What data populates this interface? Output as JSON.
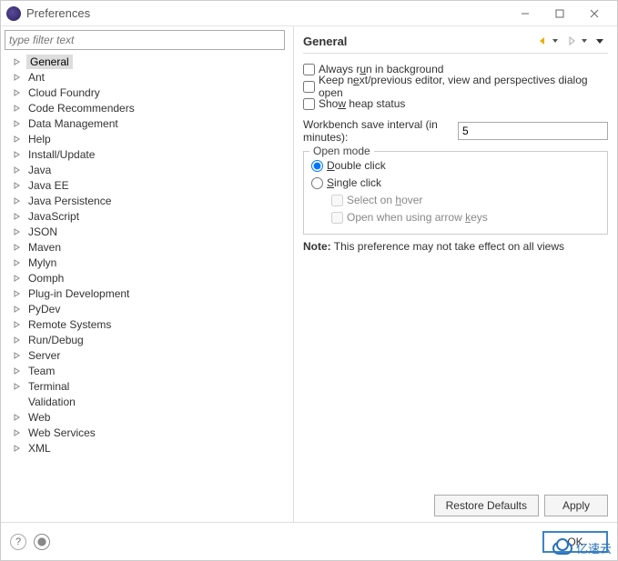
{
  "window": {
    "title": "Preferences"
  },
  "filter": {
    "placeholder": "type filter text"
  },
  "tree": {
    "items": [
      {
        "label": "General",
        "expandable": true,
        "selected": true
      },
      {
        "label": "Ant",
        "expandable": true
      },
      {
        "label": "Cloud Foundry",
        "expandable": true
      },
      {
        "label": "Code Recommenders",
        "expandable": true
      },
      {
        "label": "Data Management",
        "expandable": true
      },
      {
        "label": "Help",
        "expandable": true
      },
      {
        "label": "Install/Update",
        "expandable": true
      },
      {
        "label": "Java",
        "expandable": true
      },
      {
        "label": "Java EE",
        "expandable": true
      },
      {
        "label": "Java Persistence",
        "expandable": true
      },
      {
        "label": "JavaScript",
        "expandable": true
      },
      {
        "label": "JSON",
        "expandable": true
      },
      {
        "label": "Maven",
        "expandable": true
      },
      {
        "label": "Mylyn",
        "expandable": true
      },
      {
        "label": "Oomph",
        "expandable": true
      },
      {
        "label": "Plug-in Development",
        "expandable": true
      },
      {
        "label": "PyDev",
        "expandable": true
      },
      {
        "label": "Remote Systems",
        "expandable": true
      },
      {
        "label": "Run/Debug",
        "expandable": true
      },
      {
        "label": "Server",
        "expandable": true
      },
      {
        "label": "Team",
        "expandable": true
      },
      {
        "label": "Terminal",
        "expandable": true
      },
      {
        "label": "Validation",
        "expandable": false
      },
      {
        "label": "Web",
        "expandable": true
      },
      {
        "label": "Web Services",
        "expandable": true
      },
      {
        "label": "XML",
        "expandable": true
      }
    ]
  },
  "panel": {
    "title": "General",
    "checkboxes": {
      "always_bg": {
        "label_pre": "Always r",
        "u": "u",
        "label_post": "n in background",
        "checked": false
      },
      "keep_editor": {
        "label_pre": "Keep n",
        "u": "e",
        "label_post": "xt/previous editor, view and perspectives dialog open",
        "checked": false
      },
      "show_heap": {
        "label_pre": "Sho",
        "u": "w",
        "label_post": " heap status",
        "checked": false
      }
    },
    "interval": {
      "label_pre": "Workbench ",
      "u": "s",
      "label_post": "ave interval (in minutes):",
      "value": "5"
    },
    "open_mode": {
      "legend": "Open mode",
      "double": {
        "u": "D",
        "label": "ouble click",
        "checked": true
      },
      "single": {
        "u": "S",
        "label": "ingle click",
        "checked": false
      },
      "hover": {
        "label_pre": "Select on ",
        "u": "h",
        "label_post": "over",
        "checked": false,
        "disabled": true
      },
      "arrow": {
        "label_pre": "Open when using arrow ",
        "u": "k",
        "label_post": "eys",
        "checked": false,
        "disabled": true
      }
    },
    "note_label": "Note:",
    "note_text": " This preference may not take effect on all views",
    "buttons": {
      "restore": "Restore Defaults",
      "restore_u": "D",
      "apply": "Apply",
      "apply_u": "A"
    }
  },
  "footer": {
    "ok": "OK"
  },
  "watermark": "亿速云"
}
